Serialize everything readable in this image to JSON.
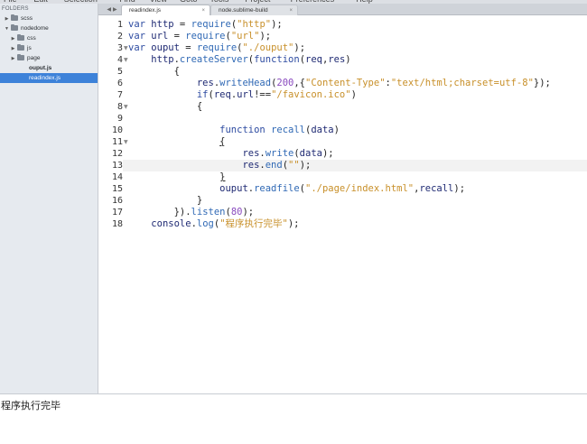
{
  "menubar": {
    "items": [
      "File",
      "Edit",
      "Selection",
      "Find",
      "View",
      "Goto",
      "Tools",
      "Project",
      "Preferences",
      "Help"
    ]
  },
  "sidebar": {
    "label": "FOLDERS",
    "tree": [
      {
        "label": "scss",
        "arrow": "▶",
        "type": "folder",
        "level": 0
      },
      {
        "label": "nodedome",
        "arrow": "▼",
        "type": "folder",
        "level": 0
      },
      {
        "label": "css",
        "arrow": "▶",
        "type": "folder",
        "level": 1
      },
      {
        "label": "js",
        "arrow": "▶",
        "type": "folder",
        "level": 1
      },
      {
        "label": "page",
        "arrow": "▶",
        "type": "folder",
        "level": 1
      },
      {
        "label": "ouput.js",
        "arrow": "",
        "type": "file",
        "level": 1
      },
      {
        "label": "readindex.js",
        "arrow": "",
        "type": "file",
        "level": 1,
        "selected": true
      }
    ]
  },
  "tabs": {
    "nav_left": "◀",
    "nav_right": "▶",
    "items": [
      {
        "label": "readindex.js",
        "close": "×",
        "active": true
      },
      {
        "label": "node.sublime-build",
        "close": "×",
        "active": false
      }
    ]
  },
  "editor": {
    "current_line": 13,
    "lines": [
      {
        "n": "1",
        "fold": "",
        "tokens": [
          [
            "kw",
            "var "
          ],
          [
            "plain",
            "http "
          ],
          [
            "pun",
            "= "
          ],
          [
            "fn",
            "require"
          ],
          [
            "pun",
            "("
          ],
          [
            "str",
            "\"http\""
          ],
          [
            "pun",
            ");"
          ]
        ]
      },
      {
        "n": "2",
        "fold": "",
        "tokens": [
          [
            "kw",
            "var "
          ],
          [
            "plain",
            "url "
          ],
          [
            "pun",
            "= "
          ],
          [
            "fn",
            "require"
          ],
          [
            "pun",
            "("
          ],
          [
            "str",
            "\"url\""
          ],
          [
            "pun",
            ");"
          ]
        ]
      },
      {
        "n": "3",
        "fold": "▼",
        "tokens": [
          [
            "kw",
            "var "
          ],
          [
            "plain",
            "ouput "
          ],
          [
            "pun",
            "= "
          ],
          [
            "fn",
            "require"
          ],
          [
            "pun",
            "("
          ],
          [
            "str",
            "\"./ouput\""
          ],
          [
            "pun",
            ");"
          ]
        ]
      },
      {
        "n": "4",
        "fold": "▼",
        "tokens": [
          [
            "plain",
            "    "
          ],
          [
            "plain",
            "http"
          ],
          [
            "pun",
            "."
          ],
          [
            "fn",
            "createServer"
          ],
          [
            "pun",
            "("
          ],
          [
            "kw",
            "function"
          ],
          [
            "pun",
            "("
          ],
          [
            "plain",
            "req"
          ],
          [
            "pun",
            ","
          ],
          [
            "plain",
            "res"
          ],
          [
            "pun",
            ")"
          ]
        ]
      },
      {
        "n": "5",
        "fold": "",
        "tokens": [
          [
            "plain",
            "        "
          ],
          [
            "pun",
            "{"
          ]
        ]
      },
      {
        "n": "6",
        "fold": "",
        "tokens": [
          [
            "plain",
            "            "
          ],
          [
            "plain",
            "res"
          ],
          [
            "pun",
            "."
          ],
          [
            "fn",
            "writeHead"
          ],
          [
            "pun",
            "("
          ],
          [
            "num",
            "200"
          ],
          [
            "pun",
            ",{"
          ],
          [
            "str",
            "\"Content-Type\""
          ],
          [
            "pun",
            ":"
          ],
          [
            "str",
            "\"text/html;charset=utf-8\""
          ],
          [
            "pun",
            "});"
          ]
        ]
      },
      {
        "n": "7",
        "fold": "",
        "tokens": [
          [
            "plain",
            "            "
          ],
          [
            "kw",
            "if"
          ],
          [
            "pun",
            "("
          ],
          [
            "plain",
            "req"
          ],
          [
            "pun",
            "."
          ],
          [
            "plain",
            "url"
          ],
          [
            "pun",
            "!=="
          ],
          [
            "str",
            "\"/favicon.ico\""
          ],
          [
            "pun",
            ")"
          ]
        ]
      },
      {
        "n": "8",
        "fold": "▼",
        "tokens": [
          [
            "plain",
            "            "
          ],
          [
            "pun",
            "{"
          ]
        ]
      },
      {
        "n": "9",
        "fold": "",
        "tokens": []
      },
      {
        "n": "10",
        "fold": "",
        "tokens": [
          [
            "plain",
            "                "
          ],
          [
            "kw",
            "function "
          ],
          [
            "fn",
            "recall"
          ],
          [
            "pun",
            "("
          ],
          [
            "plain",
            "data"
          ],
          [
            "pun",
            ")"
          ]
        ]
      },
      {
        "n": "11",
        "fold": "▼",
        "tokens": [
          [
            "plain",
            "                "
          ],
          [
            "pun",
            "{"
          ]
        ]
      },
      {
        "n": "12",
        "fold": "",
        "tokens": [
          [
            "plain",
            "                    "
          ],
          [
            "plain",
            "res"
          ],
          [
            "pun",
            "."
          ],
          [
            "fn",
            "write"
          ],
          [
            "pun",
            "("
          ],
          [
            "plain",
            "data"
          ],
          [
            "pun",
            ");"
          ]
        ]
      },
      {
        "n": "13",
        "fold": "",
        "tokens": [
          [
            "plain",
            "                    "
          ],
          [
            "plain",
            "res"
          ],
          [
            "pun",
            "."
          ],
          [
            "fn",
            "end"
          ],
          [
            "pun",
            "("
          ],
          [
            "str",
            "\"\""
          ],
          [
            "pun",
            ");"
          ]
        ]
      },
      {
        "n": "14",
        "fold": "",
        "tokens": [
          [
            "plain",
            "                "
          ],
          [
            "pun",
            "}"
          ]
        ]
      },
      {
        "n": "15",
        "fold": "",
        "tokens": [
          [
            "plain",
            "                "
          ],
          [
            "plain",
            "ouput"
          ],
          [
            "pun",
            "."
          ],
          [
            "fn",
            "readfile"
          ],
          [
            "pun",
            "("
          ],
          [
            "str",
            "\"./page/index.html\""
          ],
          [
            "pun",
            ","
          ],
          [
            "plain",
            "recall"
          ],
          [
            "pun",
            ");"
          ]
        ]
      },
      {
        "n": "16",
        "fold": "",
        "tokens": [
          [
            "plain",
            "            "
          ],
          [
            "pun",
            "}"
          ]
        ]
      },
      {
        "n": "17",
        "fold": "",
        "tokens": [
          [
            "plain",
            "        "
          ],
          [
            "pun",
            "})."
          ],
          [
            "fn",
            "listen"
          ],
          [
            "pun",
            "("
          ],
          [
            "num",
            "80"
          ],
          [
            "pun",
            ");"
          ]
        ]
      },
      {
        "n": "18",
        "fold": "",
        "tokens": [
          [
            "plain",
            "    "
          ],
          [
            "plain",
            "console"
          ],
          [
            "pun",
            "."
          ],
          [
            "fn",
            "log"
          ],
          [
            "pun",
            "("
          ],
          [
            "str",
            "\"程序执行完毕\""
          ],
          [
            "pun",
            ");"
          ]
        ]
      }
    ]
  },
  "console": {
    "output": "程序执行完毕"
  }
}
